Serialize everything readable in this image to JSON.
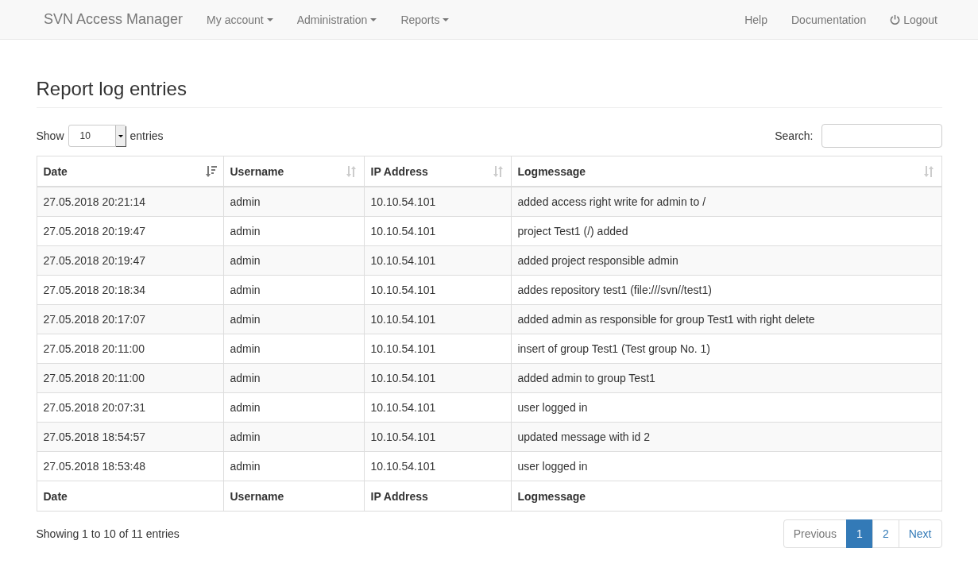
{
  "navbar": {
    "brand": "SVN Access Manager",
    "menus": [
      {
        "label": "My account",
        "dropdown": true
      },
      {
        "label": "Administration",
        "dropdown": true
      },
      {
        "label": "Reports",
        "dropdown": true
      }
    ],
    "right_links": [
      {
        "label": "Help",
        "kind": "link"
      },
      {
        "label": "Documentation",
        "kind": "link"
      },
      {
        "label": "Logout",
        "kind": "logout"
      }
    ]
  },
  "page_title": "Report log entries",
  "length_control": {
    "prefix": "Show",
    "value": "10",
    "suffix": "entries"
  },
  "search": {
    "label": "Search:"
  },
  "table": {
    "columns": [
      {
        "label": "Date",
        "sorted": true
      },
      {
        "label": "Username",
        "sorted": false
      },
      {
        "label": "IP Address",
        "sorted": false
      },
      {
        "label": "Logmessage",
        "sorted": false
      }
    ],
    "rows": [
      [
        "27.05.2018 20:21:14",
        "admin",
        "10.10.54.101",
        "added access right write for admin to /"
      ],
      [
        "27.05.2018 20:19:47",
        "admin",
        "10.10.54.101",
        "project Test1 (/) added"
      ],
      [
        "27.05.2018 20:19:47",
        "admin",
        "10.10.54.101",
        "added project responsible admin"
      ],
      [
        "27.05.2018 20:18:34",
        "admin",
        "10.10.54.101",
        "addes repository test1 (file:///svn//test1)"
      ],
      [
        "27.05.2018 20:17:07",
        "admin",
        "10.10.54.101",
        "added admin as responsible for group Test1 with right delete"
      ],
      [
        "27.05.2018 20:11:00",
        "admin",
        "10.10.54.101",
        "insert of group Test1 (Test group No. 1)"
      ],
      [
        "27.05.2018 20:11:00",
        "admin",
        "10.10.54.101",
        "added admin to group Test1"
      ],
      [
        "27.05.2018 20:07:31",
        "admin",
        "10.10.54.101",
        "user logged in"
      ],
      [
        "27.05.2018 18:54:57",
        "admin",
        "10.10.54.101",
        "updated message with id 2"
      ],
      [
        "27.05.2018 18:53:48",
        "admin",
        "10.10.54.101",
        "user logged in"
      ]
    ],
    "footer": [
      "Date",
      "Username",
      "IP Address",
      "Logmessage"
    ]
  },
  "info": "Showing 1 to 10 of 11 entries",
  "pagination": [
    {
      "label": "Previous",
      "selected": false,
      "disabled": true
    },
    {
      "label": "1",
      "selected": true,
      "disabled": false
    },
    {
      "label": "2",
      "selected": false,
      "disabled": false
    },
    {
      "label": "Next",
      "selected": false,
      "disabled": false
    }
  ]
}
